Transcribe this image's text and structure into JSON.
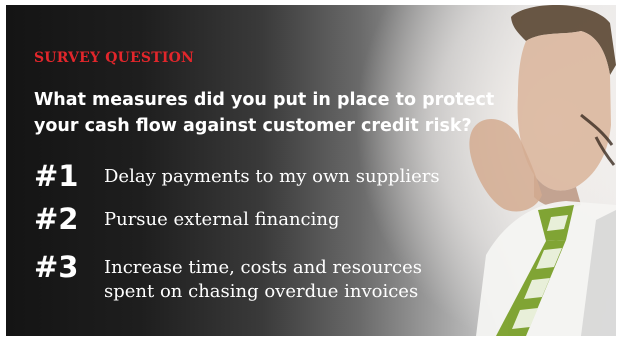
{
  "kicker": "SURVEY QUESTION",
  "question": "What measures did you put in place to protect your cash flow against customer credit risk?",
  "answers": [
    {
      "rank": "#1",
      "text": "Delay payments to my own suppliers"
    },
    {
      "rank": "#2",
      "text": "Pursue external financing"
    },
    {
      "rank": "#3",
      "text": "Increase time, costs and resources spent on chasing overdue invoices"
    }
  ],
  "colors": {
    "kicker": "#e2262b",
    "text": "#ffffff",
    "tie_green": "#7aa02a"
  },
  "image": {
    "subject": "businessman-photo"
  }
}
